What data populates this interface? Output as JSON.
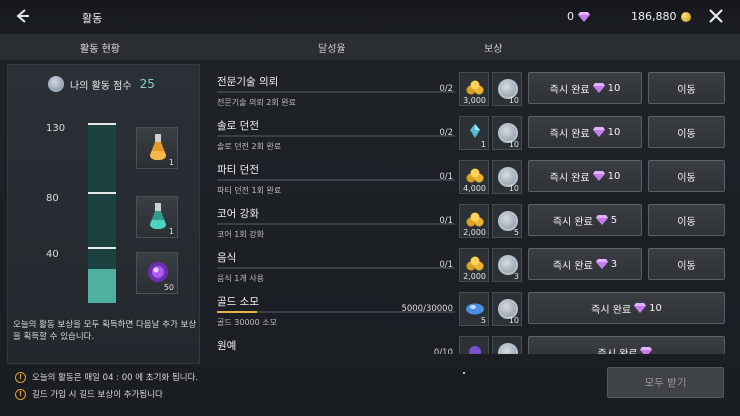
{
  "header": {
    "title": "활동",
    "gem_count": "0",
    "gold_count": "186,880"
  },
  "tabs": [
    {
      "label": "활동 현황"
    },
    {
      "label": "달성율"
    },
    {
      "label": "보상"
    }
  ],
  "left_panel": {
    "score_label": "나의 활동 점수",
    "score_value": "25",
    "score_progress_fraction": 0.19,
    "thresholds": [
      {
        "label": "130"
      },
      {
        "label": "80"
      },
      {
        "label": "40"
      }
    ],
    "rewards": [
      {
        "icon": "orange-potion-icon",
        "count": "1"
      },
      {
        "icon": "teal-potion-icon",
        "count": "1"
      },
      {
        "icon": "purple-orb-icon",
        "count": "50"
      }
    ],
    "note": "오늘의 활동 보상을 모두 획득하면 다음날 추가 보상을 획득할 수 있습니다."
  },
  "activities": [
    {
      "name": "전문기술 의뢰",
      "desc": "전문기술 의뢰 2회 완료",
      "progress": "0/2",
      "fill": 0.0,
      "item_a": {
        "icon": "gold-pile-icon",
        "count": "3,000"
      },
      "item_b": {
        "icon": "activity-coin-icon",
        "count": "10"
      },
      "instant_label": "즉시 완료",
      "gem_cost": "10",
      "move_label": "이동"
    },
    {
      "name": "솔로 던전",
      "desc": "솔로 던전 2회 완료",
      "progress": "0/2",
      "fill": 0.0,
      "item_a": {
        "icon": "blue-crystal-icon",
        "count": "1"
      },
      "item_b": {
        "icon": "activity-coin-icon",
        "count": "10"
      },
      "instant_label": "즉시 완료",
      "gem_cost": "10",
      "move_label": "이동"
    },
    {
      "name": "파티 던전",
      "desc": "파티 던전 1회 완료",
      "progress": "0/1",
      "fill": 0.0,
      "item_a": {
        "icon": "gold-pile-icon",
        "count": "4,000"
      },
      "item_b": {
        "icon": "activity-coin-icon",
        "count": "10"
      },
      "instant_label": "즉시 완료",
      "gem_cost": "10",
      "move_label": "이동"
    },
    {
      "name": "코어 강화",
      "desc": "코어 1회 강화",
      "progress": "0/1",
      "fill": 0.0,
      "item_a": {
        "icon": "gold-pile-icon",
        "count": "2,000"
      },
      "item_b": {
        "icon": "activity-coin-icon",
        "count": "5"
      },
      "instant_label": "즉시 완료",
      "gem_cost": "5",
      "move_label": "이동"
    },
    {
      "name": "음식",
      "desc": "음식 1개 사용",
      "progress": "0/1",
      "fill": 0.0,
      "item_a": {
        "icon": "gold-pile-icon",
        "count": "2,000"
      },
      "item_b": {
        "icon": "activity-coin-icon",
        "count": "3"
      },
      "instant_label": "즉시 완료",
      "gem_cost": "3",
      "move_label": "이동"
    },
    {
      "name": "골드 소모",
      "desc": "골드 30000 소모",
      "progress": "5000/30000",
      "fill": 0.167,
      "item_a": {
        "icon": "blue-slime-icon",
        "count": "5"
      },
      "item_b": {
        "icon": "activity-coin-icon",
        "count": "10"
      },
      "instant_label": "즉시 완료",
      "gem_cost": "10",
      "move_label": ""
    },
    {
      "name": "원예",
      "desc": "",
      "progress": "0/10",
      "fill": 0.0,
      "item_a": {
        "icon": "purple-item-icon",
        "count": ""
      },
      "item_b": {
        "icon": "activity-coin-icon",
        "count": ""
      },
      "instant_label": "즉시 완료",
      "gem_cost": "",
      "move_label": ""
    }
  ],
  "bottom": {
    "note1": "오늘의 활동은 매일  04 : 00  에 초기화 됩니다.",
    "note2": "길드 가입 시 길드 보상이 추가됩니다",
    "claim_all_label": "모두 받기"
  },
  "colors": {
    "accent_teal": "#4fb0a0",
    "gem_purple": "#c77df0",
    "gold": "#e8b04a"
  }
}
